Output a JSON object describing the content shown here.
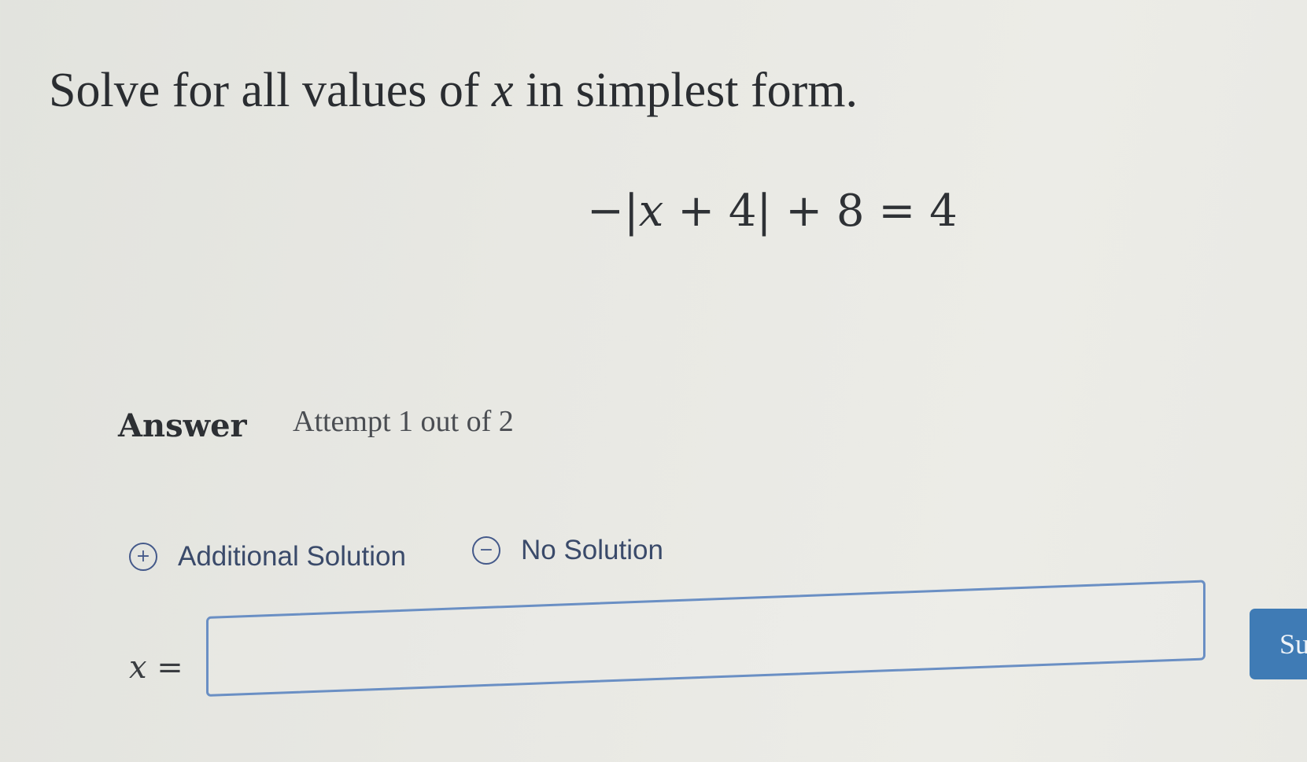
{
  "prompt": {
    "before": "Solve for all values of ",
    "var": "x",
    "after": " in simplest form."
  },
  "equation": {
    "lead": "−|",
    "var": "x",
    "rest": " + 4| + 8 = 4"
  },
  "answer": {
    "label": "Answer",
    "attempt": "Attempt 1 out of 2"
  },
  "options": {
    "additional_solution": {
      "label": "Additional Solution",
      "icon": "plus-circle-icon",
      "glyph": "+"
    },
    "no_solution": {
      "label": "No Solution",
      "icon": "minus-circle-icon",
      "glyph": "−"
    }
  },
  "input": {
    "var": "x",
    "equals": " =",
    "value": ""
  },
  "submit": {
    "label": "Su"
  },
  "colors": {
    "accent": "#3f7bb5",
    "input_border": "#6a8fc4",
    "option_text": "#3a4a6a"
  }
}
